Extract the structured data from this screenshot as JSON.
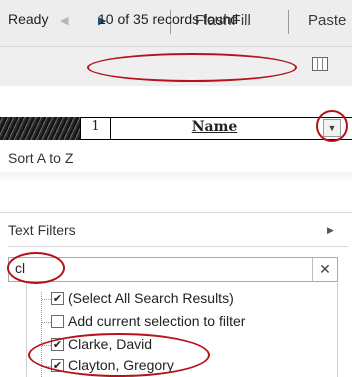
{
  "sheet_tabs": {
    "prev_icon": "triangle-left-icon",
    "next_icon": "triangle-right-icon",
    "tabs": [
      "FlashFill",
      "Paste"
    ]
  },
  "status_bar": {
    "ready": "Ready",
    "record_count": "10 of 35 records found",
    "view_icon": "normal-view-icon",
    "annotation_color": "#b5121b"
  },
  "header": {
    "row_number": "1",
    "column_name": "Name",
    "filter_icon": "dropdown-arrow-icon"
  },
  "menu": {
    "sort_az": "Sort A to Z",
    "text_filters": "Text Filters",
    "search_value": "cl",
    "clear_icon": "clear-x-icon",
    "items": [
      {
        "label": "(Select All Search Results)",
        "checked": true
      },
      {
        "label": "Add current selection to filter",
        "checked": false
      },
      {
        "label": "Clarke, David",
        "checked": true
      },
      {
        "label": "Clayton, Gregory",
        "checked": true
      }
    ]
  }
}
